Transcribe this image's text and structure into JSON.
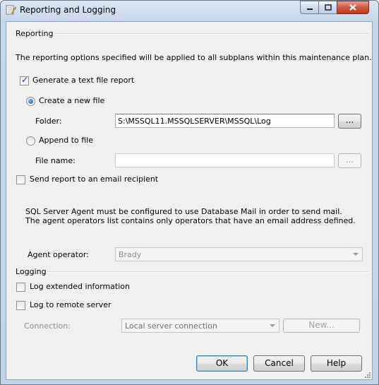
{
  "window": {
    "title": "Reporting and Logging"
  },
  "reporting": {
    "section_label": "Reporting",
    "description": "The reporting options specified will be applied to all subplans within this maintenance plan.",
    "generate_text_report": {
      "label": "Generate a text file report",
      "checked": true
    },
    "create_new_file": {
      "label": "Create a new file",
      "selected": true
    },
    "folder": {
      "label": "Folder:",
      "value": "S:\\MSSQL11.MSSQLSERVER\\MSSQL\\Log",
      "browse_label": "..."
    },
    "append_to_file": {
      "label": "Append to file",
      "selected": false
    },
    "file_name": {
      "label": "File name:",
      "value": "",
      "browse_label": "..."
    },
    "send_email": {
      "label": "Send report to an email recipient",
      "checked": false
    },
    "agent_note": "SQL Server Agent must be configured to use Database Mail in order to send mail. The agent operators list contains only operators that have an email address defined.",
    "agent_operator": {
      "label": "Agent operator:",
      "value": "Brady"
    }
  },
  "logging": {
    "section_label": "Logging",
    "log_extended": {
      "label": "Log extended information",
      "checked": false
    },
    "log_remote": {
      "label": "Log to remote server",
      "checked": false
    },
    "connection": {
      "label": "Connection:",
      "value": "Local server connection",
      "new_label": "New..."
    }
  },
  "buttons": {
    "ok": "OK",
    "cancel": "Cancel",
    "help": "Help"
  }
}
